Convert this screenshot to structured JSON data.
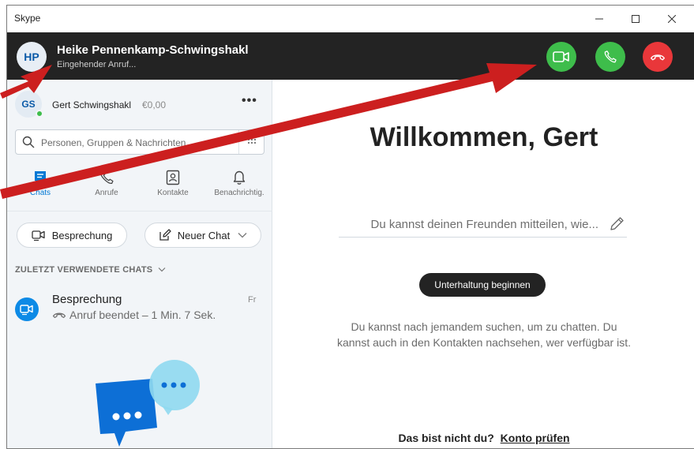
{
  "window": {
    "title": "Skype"
  },
  "call": {
    "caller_initials": "HP",
    "caller_name": "Heike Pennenkamp-Schwingshakl",
    "status": "Eingehender Anruf..."
  },
  "profile": {
    "initials": "GS",
    "name": "Gert Schwingshakl",
    "credit": "€0,00",
    "more": "•••"
  },
  "search": {
    "placeholder": "Personen, Gruppen & Nachrichten"
  },
  "nav": {
    "tabs": [
      {
        "label": "Chats",
        "icon": "chat-icon",
        "active": true
      },
      {
        "label": "Anrufe",
        "icon": "phone-icon"
      },
      {
        "label": "Kontakte",
        "icon": "contacts-icon"
      },
      {
        "label": "Benachrichtig.",
        "icon": "bell-icon"
      }
    ]
  },
  "actions": {
    "meeting_label": "Besprechung",
    "new_chat_label": "Neuer Chat"
  },
  "recent": {
    "header": "ZULETZT VERWENDETE CHATS",
    "items": [
      {
        "name": "Besprechung",
        "preview": "Anruf beendet – 1 Min. 7 Sek.",
        "date": "Fr"
      }
    ]
  },
  "main": {
    "welcome": "Willkommen, Gert",
    "mood_placeholder": "Du kannst deinen Freunden mitteilen, wie...",
    "start_label": "Unterhaltung beginnen",
    "hint": "Du kannst nach jemandem suchen, um zu chatten. Du kannst auch in den Kontakten nachsehen, wer verfügbar ist.",
    "not_you": "Das bist nicht du?",
    "check_account": "Konto prüfen"
  },
  "colors": {
    "accent": "#0078d4",
    "call_green": "#3ebd4b",
    "hangup_red": "#e9373a",
    "annotation_arrow": "#cc1f1f",
    "callbar": "#232323"
  }
}
